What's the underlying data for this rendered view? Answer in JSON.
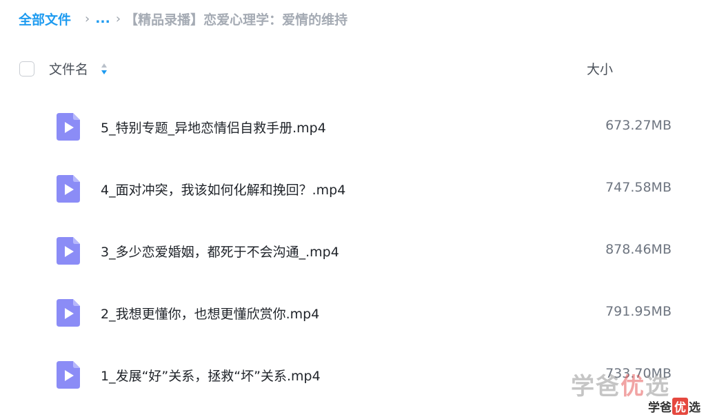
{
  "breadcrumb": {
    "root": "全部文件",
    "ellipsis": "...",
    "current": "【精品录播】恋爱心理学：爱情的维持"
  },
  "header": {
    "name_label": "文件名",
    "size_label": "大小"
  },
  "files": [
    {
      "name": "5_特别专题_异地恋情侣自救手册.mp4",
      "size": "673.27MB"
    },
    {
      "name": "4_面对冲突，我该如何化解和挽回？.mp4",
      "size": "747.58MB"
    },
    {
      "name": "3_多少恋爱婚姻，都死于不会沟通_.mp4",
      "size": "878.46MB"
    },
    {
      "name": "2_我想更懂你，也想更懂欣赏你.mp4",
      "size": "791.95MB"
    },
    {
      "name": "1_发展“好”关系，拯救“坏”关系.mp4",
      "size": "733.70MB"
    }
  ],
  "watermark": {
    "big_a": "学",
    "big_b": "爸",
    "big_c": "优",
    "big_d": "选",
    "small_a": "学爸",
    "small_b": "优",
    "small_c": "选"
  },
  "colors": {
    "accent": "#1e9bf0",
    "video_icon": "#8b8cf6"
  }
}
